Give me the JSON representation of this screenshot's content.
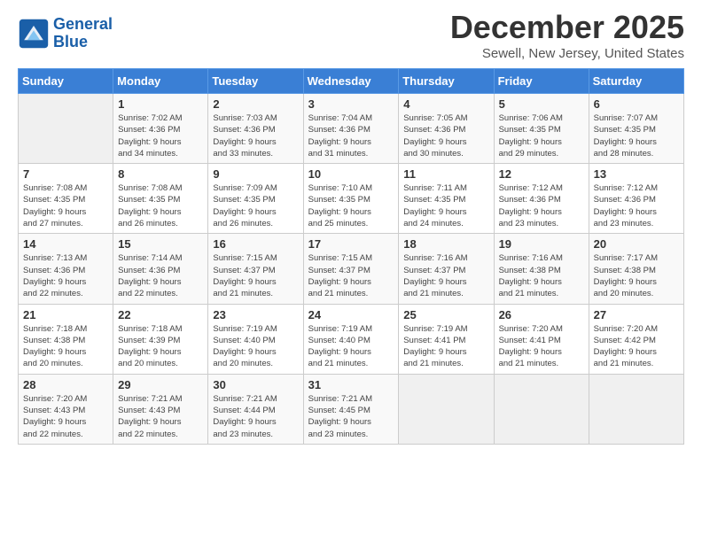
{
  "header": {
    "logo_line1": "General",
    "logo_line2": "Blue",
    "title": "December 2025",
    "subtitle": "Sewell, New Jersey, United States"
  },
  "days_of_week": [
    "Sunday",
    "Monday",
    "Tuesday",
    "Wednesday",
    "Thursday",
    "Friday",
    "Saturday"
  ],
  "weeks": [
    [
      {
        "day": "",
        "info": ""
      },
      {
        "day": "1",
        "info": "Sunrise: 7:02 AM\nSunset: 4:36 PM\nDaylight: 9 hours\nand 34 minutes."
      },
      {
        "day": "2",
        "info": "Sunrise: 7:03 AM\nSunset: 4:36 PM\nDaylight: 9 hours\nand 33 minutes."
      },
      {
        "day": "3",
        "info": "Sunrise: 7:04 AM\nSunset: 4:36 PM\nDaylight: 9 hours\nand 31 minutes."
      },
      {
        "day": "4",
        "info": "Sunrise: 7:05 AM\nSunset: 4:36 PM\nDaylight: 9 hours\nand 30 minutes."
      },
      {
        "day": "5",
        "info": "Sunrise: 7:06 AM\nSunset: 4:35 PM\nDaylight: 9 hours\nand 29 minutes."
      },
      {
        "day": "6",
        "info": "Sunrise: 7:07 AM\nSunset: 4:35 PM\nDaylight: 9 hours\nand 28 minutes."
      }
    ],
    [
      {
        "day": "7",
        "info": "Sunrise: 7:08 AM\nSunset: 4:35 PM\nDaylight: 9 hours\nand 27 minutes."
      },
      {
        "day": "8",
        "info": "Sunrise: 7:08 AM\nSunset: 4:35 PM\nDaylight: 9 hours\nand 26 minutes."
      },
      {
        "day": "9",
        "info": "Sunrise: 7:09 AM\nSunset: 4:35 PM\nDaylight: 9 hours\nand 26 minutes."
      },
      {
        "day": "10",
        "info": "Sunrise: 7:10 AM\nSunset: 4:35 PM\nDaylight: 9 hours\nand 25 minutes."
      },
      {
        "day": "11",
        "info": "Sunrise: 7:11 AM\nSunset: 4:35 PM\nDaylight: 9 hours\nand 24 minutes."
      },
      {
        "day": "12",
        "info": "Sunrise: 7:12 AM\nSunset: 4:36 PM\nDaylight: 9 hours\nand 23 minutes."
      },
      {
        "day": "13",
        "info": "Sunrise: 7:12 AM\nSunset: 4:36 PM\nDaylight: 9 hours\nand 23 minutes."
      }
    ],
    [
      {
        "day": "14",
        "info": "Sunrise: 7:13 AM\nSunset: 4:36 PM\nDaylight: 9 hours\nand 22 minutes."
      },
      {
        "day": "15",
        "info": "Sunrise: 7:14 AM\nSunset: 4:36 PM\nDaylight: 9 hours\nand 22 minutes."
      },
      {
        "day": "16",
        "info": "Sunrise: 7:15 AM\nSunset: 4:37 PM\nDaylight: 9 hours\nand 21 minutes."
      },
      {
        "day": "17",
        "info": "Sunrise: 7:15 AM\nSunset: 4:37 PM\nDaylight: 9 hours\nand 21 minutes."
      },
      {
        "day": "18",
        "info": "Sunrise: 7:16 AM\nSunset: 4:37 PM\nDaylight: 9 hours\nand 21 minutes."
      },
      {
        "day": "19",
        "info": "Sunrise: 7:16 AM\nSunset: 4:38 PM\nDaylight: 9 hours\nand 21 minutes."
      },
      {
        "day": "20",
        "info": "Sunrise: 7:17 AM\nSunset: 4:38 PM\nDaylight: 9 hours\nand 20 minutes."
      }
    ],
    [
      {
        "day": "21",
        "info": "Sunrise: 7:18 AM\nSunset: 4:38 PM\nDaylight: 9 hours\nand 20 minutes."
      },
      {
        "day": "22",
        "info": "Sunrise: 7:18 AM\nSunset: 4:39 PM\nDaylight: 9 hours\nand 20 minutes."
      },
      {
        "day": "23",
        "info": "Sunrise: 7:19 AM\nSunset: 4:40 PM\nDaylight: 9 hours\nand 20 minutes."
      },
      {
        "day": "24",
        "info": "Sunrise: 7:19 AM\nSunset: 4:40 PM\nDaylight: 9 hours\nand 21 minutes."
      },
      {
        "day": "25",
        "info": "Sunrise: 7:19 AM\nSunset: 4:41 PM\nDaylight: 9 hours\nand 21 minutes."
      },
      {
        "day": "26",
        "info": "Sunrise: 7:20 AM\nSunset: 4:41 PM\nDaylight: 9 hours\nand 21 minutes."
      },
      {
        "day": "27",
        "info": "Sunrise: 7:20 AM\nSunset: 4:42 PM\nDaylight: 9 hours\nand 21 minutes."
      }
    ],
    [
      {
        "day": "28",
        "info": "Sunrise: 7:20 AM\nSunset: 4:43 PM\nDaylight: 9 hours\nand 22 minutes."
      },
      {
        "day": "29",
        "info": "Sunrise: 7:21 AM\nSunset: 4:43 PM\nDaylight: 9 hours\nand 22 minutes."
      },
      {
        "day": "30",
        "info": "Sunrise: 7:21 AM\nSunset: 4:44 PM\nDaylight: 9 hours\nand 23 minutes."
      },
      {
        "day": "31",
        "info": "Sunrise: 7:21 AM\nSunset: 4:45 PM\nDaylight: 9 hours\nand 23 minutes."
      },
      {
        "day": "",
        "info": ""
      },
      {
        "day": "",
        "info": ""
      },
      {
        "day": "",
        "info": ""
      }
    ]
  ]
}
